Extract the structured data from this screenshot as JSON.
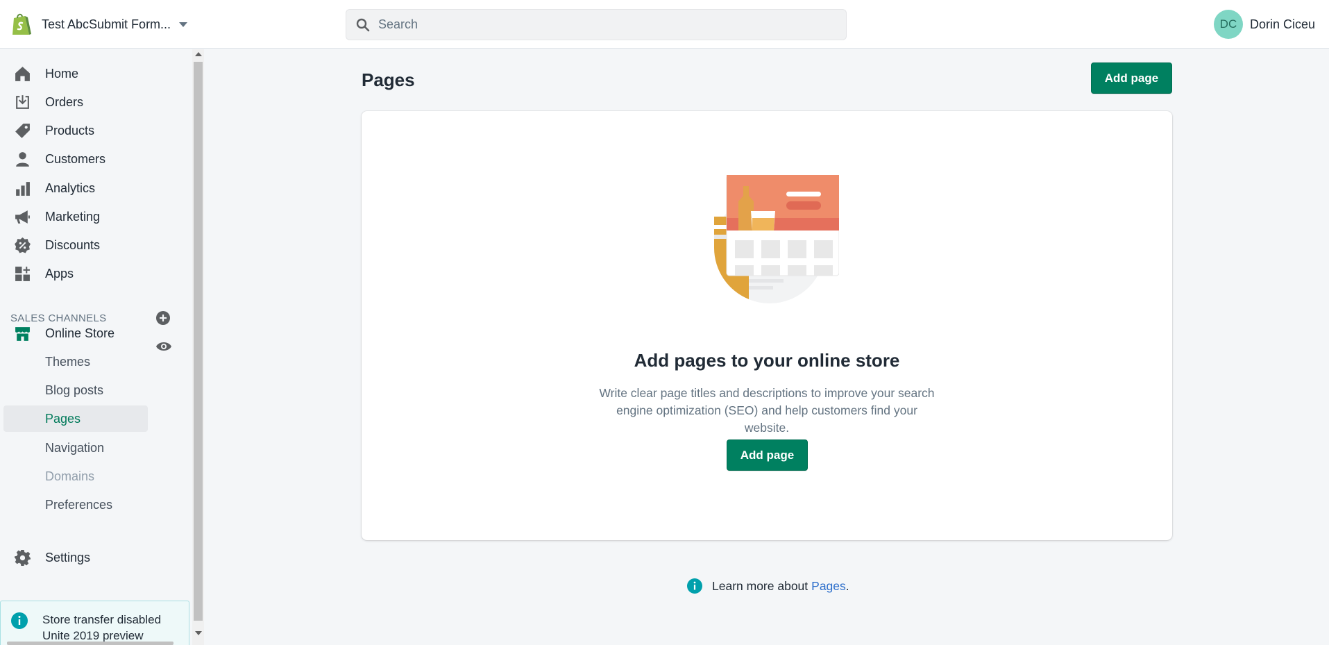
{
  "header": {
    "store_name": "Test AbcSubmit Form...",
    "search_placeholder": "Search",
    "user_initials": "DC",
    "user_name": "Dorin Ciceu"
  },
  "sidebar": {
    "items": [
      {
        "label": "Home",
        "icon": "home-icon"
      },
      {
        "label": "Orders",
        "icon": "orders-icon"
      },
      {
        "label": "Products",
        "icon": "tag-icon"
      },
      {
        "label": "Customers",
        "icon": "person-icon"
      },
      {
        "label": "Analytics",
        "icon": "bar-chart-icon"
      },
      {
        "label": "Marketing",
        "icon": "megaphone-icon"
      },
      {
        "label": "Discounts",
        "icon": "discount-icon"
      },
      {
        "label": "Apps",
        "icon": "apps-icon"
      }
    ],
    "sales_channels_heading": "SALES CHANNELS",
    "online_store": {
      "label": "Online Store",
      "sub_items": [
        {
          "label": "Themes"
        },
        {
          "label": "Blog posts"
        },
        {
          "label": "Pages",
          "active": true
        },
        {
          "label": "Navigation"
        },
        {
          "label": "Domains",
          "disabled": true
        },
        {
          "label": "Preferences"
        }
      ]
    },
    "settings_label": "Settings",
    "banner": {
      "title": "Store transfer disabled",
      "subtitle": "Unite 2019 preview"
    }
  },
  "main": {
    "title": "Pages",
    "add_page_label": "Add page",
    "empty_state": {
      "heading": "Add pages to your online store",
      "body": "Write clear page titles and descriptions to improve your search engine optimization (SEO) and help customers find your website.",
      "button_label": "Add page"
    },
    "footer": {
      "prefix": "Learn more about",
      "link": "Pages",
      "suffix": "."
    }
  },
  "colors": {
    "primary": "#008060",
    "active_text": "#007a5a",
    "link": "#2c6ecb",
    "info": "#00a0ac"
  }
}
